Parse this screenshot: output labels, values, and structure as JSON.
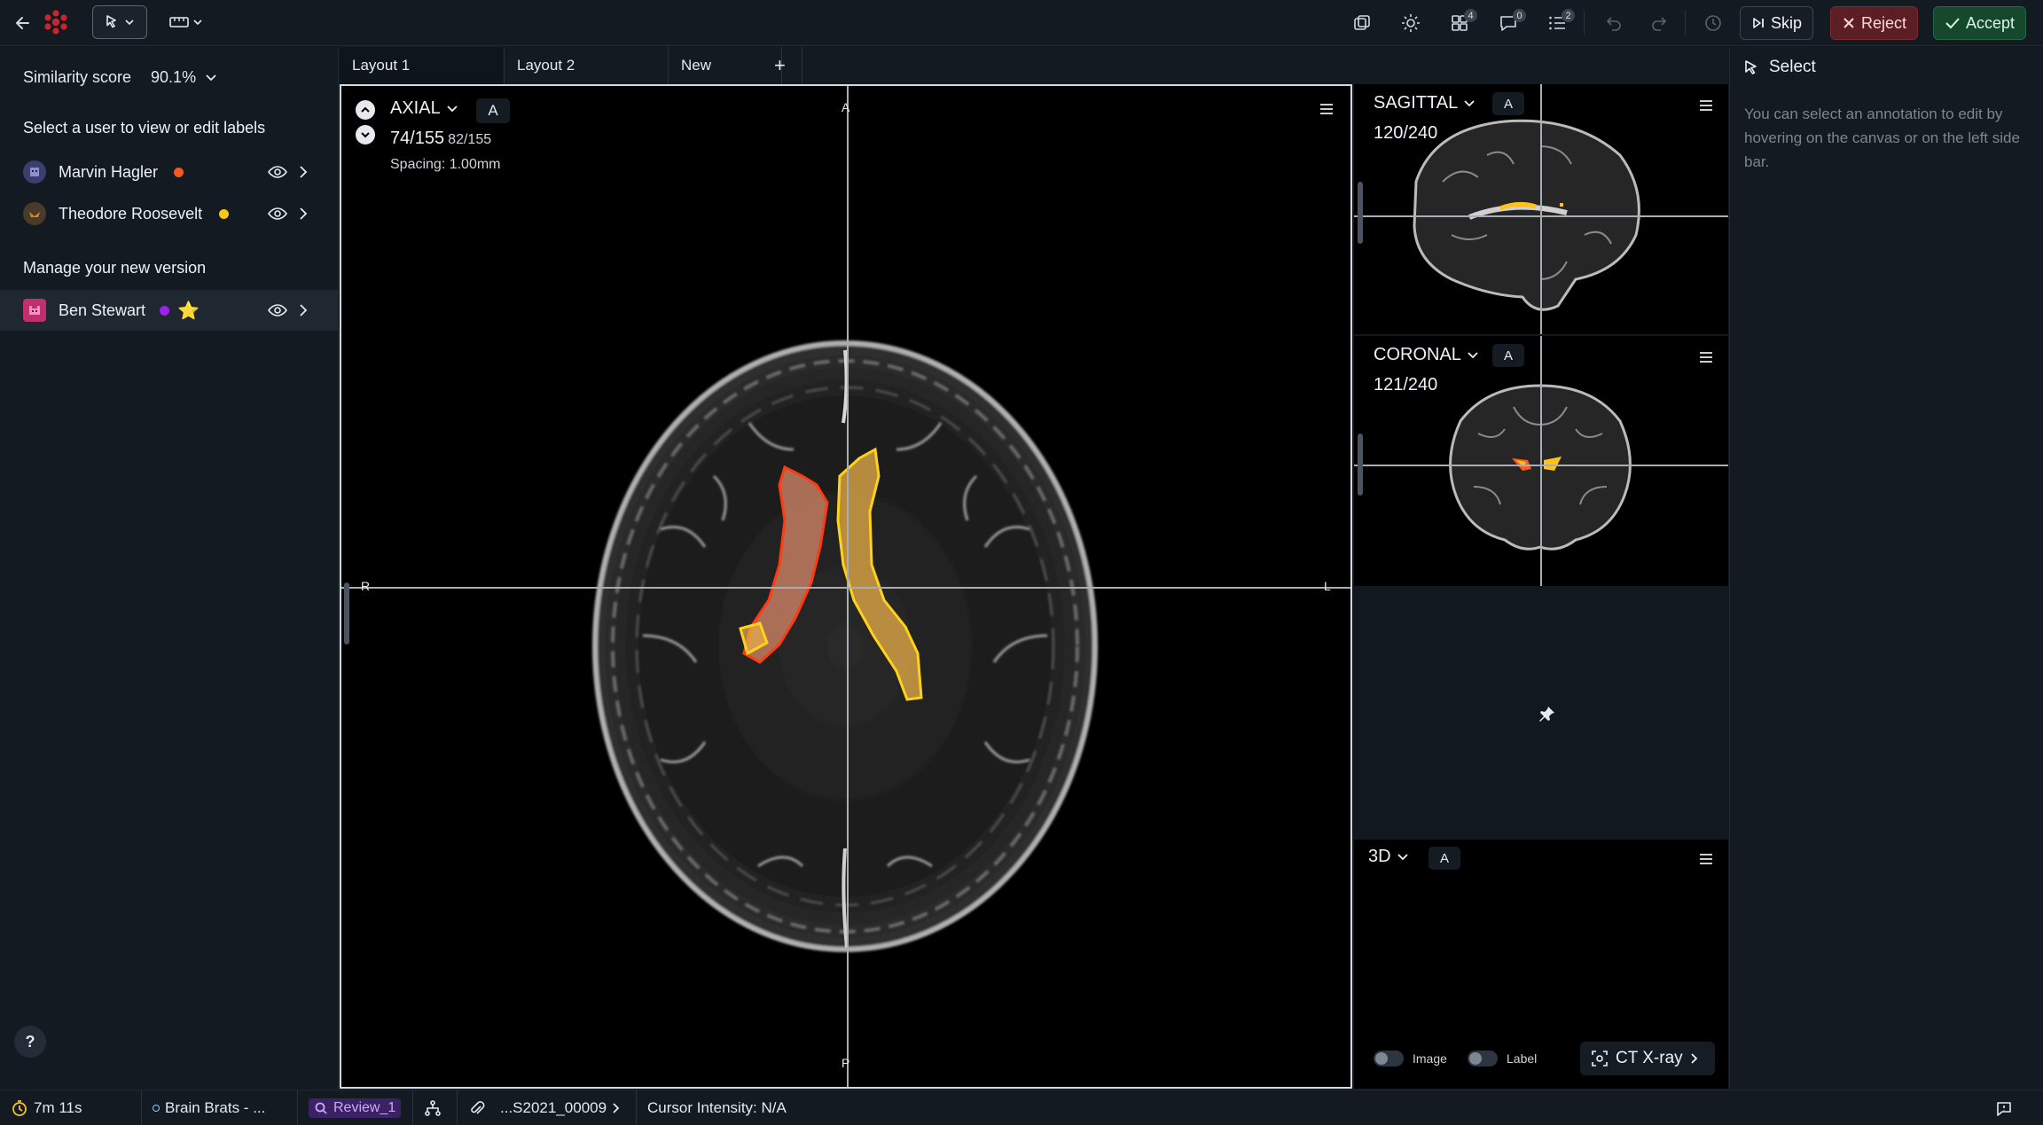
{
  "toolbar": {
    "back_icon": "arrow-left-icon",
    "logo_icon": "app-logo-icon",
    "tools": [
      "pointer-select-icon",
      "ruler-icon"
    ],
    "right_icons": [
      {
        "name": "layers-icon",
        "badge": ""
      },
      {
        "name": "brightness-icon",
        "badge": ""
      },
      {
        "name": "grid-icon",
        "badge": "4"
      },
      {
        "name": "comment-icon",
        "badge": "0"
      },
      {
        "name": "list-icon",
        "badge": "2"
      }
    ],
    "skip_label": "Skip",
    "reject_label": "Reject",
    "accept_label": "Accept",
    "colors": {
      "reject": "#5b1e23",
      "accept": "#16482d"
    }
  },
  "sidebar": {
    "similarity_label": "Similarity score",
    "similarity_value": "90.1%",
    "select_user_title": "Select a user to view or edit labels",
    "users": [
      {
        "name": "Marvin Hagler",
        "dot_color": "#f05a1e",
        "avatar_color": "#3a3f6e"
      },
      {
        "name": "Theodore Roosevelt",
        "dot_color": "#f5c518",
        "avatar_color": "#4a3a2a"
      }
    ],
    "manage_title": "Manage your new version",
    "current_user": {
      "name": "Ben Stewart",
      "dot_color": "#a020f0",
      "avatar_color": "#c0306e",
      "star": "⭐"
    },
    "help_label": "?"
  },
  "tabs": [
    {
      "label": "Layout 1"
    },
    {
      "label": "Layout 2"
    },
    {
      "label": "New"
    }
  ],
  "tab_add_label": "+",
  "axial": {
    "title": "AXIAL",
    "a_label": "A",
    "slice": "74/155",
    "slice_secondary": "82/155",
    "spacing": "Spacing: 1.00mm",
    "orient_top": "A",
    "orient_bottom": "P",
    "orient_left": "R",
    "orient_right": "L"
  },
  "sagittal": {
    "title": "SAGITTAL",
    "a_label": "A",
    "slice": "120/240"
  },
  "coronal": {
    "title": "CORONAL",
    "a_label": "A",
    "slice": "121/240"
  },
  "three_d": {
    "title": "3D",
    "a_label": "A",
    "image_toggle": "Image",
    "label_toggle": "Label",
    "modality": "CT X-ray"
  },
  "right_panel": {
    "title": "Select",
    "description": "You can select an annotation to edit by hovering on the canvas or on the left side bar."
  },
  "status": {
    "timer": "7m 11s",
    "project": "Brain Brats - ...",
    "review": "Review_1",
    "file": "...S2021_00009",
    "cursor": "Cursor Intensity: N/A"
  }
}
